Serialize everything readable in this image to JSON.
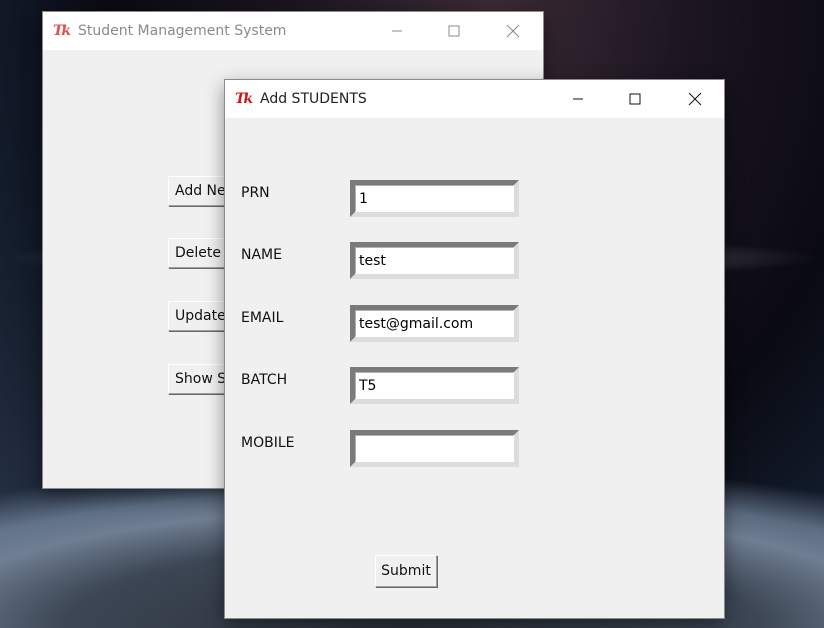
{
  "background": {
    "desc_colors": [
      "#0a0a12",
      "#6f7e92"
    ]
  },
  "main_window": {
    "title": "Student Management System",
    "icon": "tk-icon",
    "buttons": [
      {
        "label": "Add New Student"
      },
      {
        "label": "Delete Student"
      },
      {
        "label": "Update Student"
      },
      {
        "label": "Show STUDENTS"
      }
    ]
  },
  "add_window": {
    "title": "Add STUDENTS",
    "icon": "tk-icon",
    "fields": [
      {
        "label": "PRN",
        "value": "1"
      },
      {
        "label": "NAME",
        "value": "test"
      },
      {
        "label": "EMAIL",
        "value": "test@gmail.com"
      },
      {
        "label": "BATCH",
        "value": "T5"
      },
      {
        "label": "MOBILE",
        "value": ""
      }
    ],
    "submit_label": "Submit"
  },
  "controls": {
    "minimize": "minimize-icon",
    "maximize": "maximize-icon",
    "close": "close-icon"
  }
}
